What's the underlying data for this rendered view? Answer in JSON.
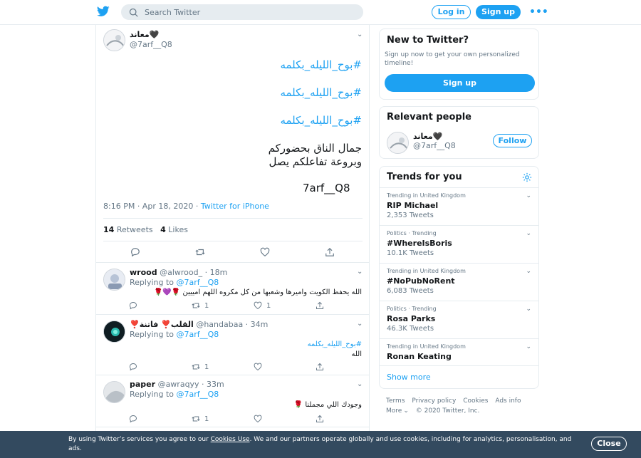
{
  "header": {
    "search_placeholder": "Search Twitter",
    "login_label": "Log in",
    "signup_label": "Sign up",
    "more_label": "•••"
  },
  "main_tweet": {
    "name": "معاند🖤",
    "handle": "@7arf__Q8",
    "hashtags": [
      "#بوح_الليله_بكلمه",
      "#بوح_الليله_بكلمه",
      "#بوح_الليله_بكلمه"
    ],
    "lines": [
      "جمال الناق بحضوركم",
      "وبروعة تفاعلكم يصل"
    ],
    "signature": "7arf__Q8",
    "timestamp": "8:16 PM · Apr 18, 2020 · ",
    "source": "Twitter for iPhone",
    "retweets_count": "14",
    "retweets_label": "Retweets",
    "likes_count": "4",
    "likes_label": "Likes"
  },
  "replies": [
    {
      "name": "wrood",
      "handle": "@alwrood_ · 18m",
      "replying_prefix": "Replying to ",
      "replying_to": "@7arf__Q8",
      "text": "الله يحفظ الكويت واميرها وشعبها من كل مكروه اللهم امييين 🌹💜🌹",
      "text2": "",
      "retweets": "1",
      "likes": "1"
    },
    {
      "name": "❣️القلب❣️ فاتنة",
      "handle": "@handabaa · 34m",
      "replying_prefix": "Replying to ",
      "replying_to": "@7arf__Q8",
      "text": "#بوح_الليله_بكلمه",
      "text2": "الله",
      "retweets": "1",
      "likes": ""
    },
    {
      "name": "paper",
      "handle": "@awraqyy · 33m",
      "replying_prefix": "Replying to ",
      "replying_to": "@7arf__Q8",
      "text": "وجودك اللي مجملنا 🌹",
      "text2": "",
      "retweets": "1",
      "likes": ""
    }
  ],
  "sidebar": {
    "new_title": "New to Twitter?",
    "new_sub": "Sign up now to get your own personalized timeline!",
    "new_btn": "Sign up",
    "relevant_title": "Relevant people",
    "relevant_name": "معاند🖤",
    "relevant_handle": "@7arf__Q8",
    "follow_label": "Follow",
    "trends_title": "Trends for you",
    "trends": [
      {
        "context": "Trending in United Kingdom",
        "title": "RIP Michael",
        "count": "2,353 Tweets"
      },
      {
        "context": "Politics · Trending",
        "title": "#WhereIsBoris",
        "count": "10.1K Tweets"
      },
      {
        "context": "Trending in United Kingdom",
        "title": "#NoPubNoRent",
        "count": "6,083 Tweets"
      },
      {
        "context": "Politics · Trending",
        "title": "Rosa Parks",
        "count": "46.3K Tweets"
      },
      {
        "context": "Trending in United Kingdom",
        "title": "Ronan Keating",
        "count": ""
      }
    ],
    "show_more": "Show more"
  },
  "footer": {
    "links": [
      "Terms",
      "Privacy policy",
      "Cookies",
      "Ads info"
    ],
    "more": "More",
    "copyright": "© 2020 Twitter, Inc."
  },
  "cookie": {
    "text_before": "By using Twitter’s services you agree to our ",
    "link": "Cookies Use",
    "text_after": ". We and our partners operate globally and use cookies, including for analytics, personalisation, and ads.",
    "close": "Close"
  },
  "colors": {
    "accent": "#1da1f2",
    "border": "#e6ecf0",
    "muted": "#657786",
    "cookie_bg": "#334a5f"
  }
}
